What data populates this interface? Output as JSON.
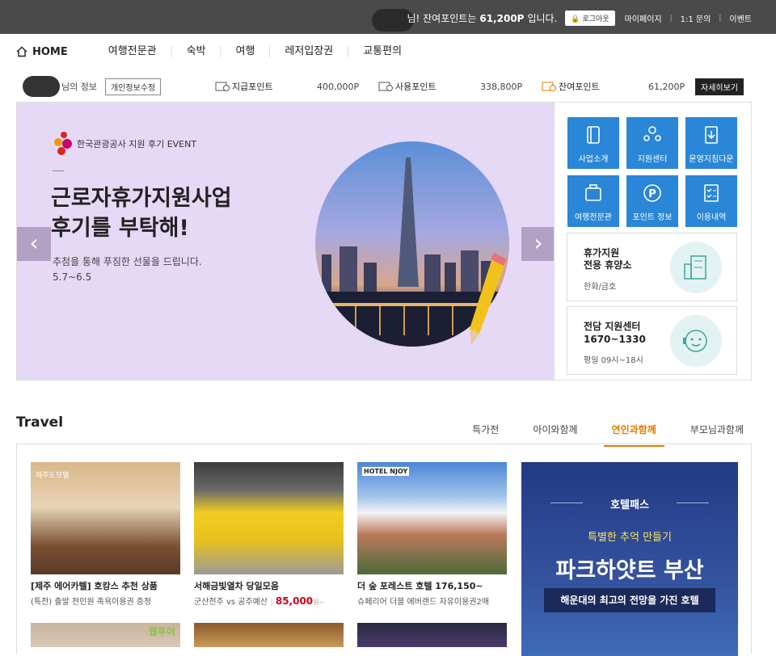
{
  "topbar": {
    "greeting": "님! 잔여포인트는",
    "points": "61,200P",
    "suffix": "입니다.",
    "logout": "로그아웃",
    "links": [
      "마이페이지",
      "1:1 문의",
      "이벤트"
    ]
  },
  "gnb": {
    "home": "HOME",
    "menus": [
      "여행전문관",
      "숙박",
      "여행",
      "레저입장권",
      "교통편의"
    ]
  },
  "info": {
    "label": "님의 정보",
    "edit": "개인정보수정",
    "given_label": "지급포인트",
    "given_value": "400,000P",
    "used_label": "사용포인트",
    "used_value": "338,800P",
    "remain_label": "잔여포인트",
    "remain_value": "61,200P",
    "detail": "자세히보기"
  },
  "banner": {
    "brand": "한국관광공사 지원 후기 EVENT",
    "headline1": "근로자휴가지원사업",
    "headline2": "후기를 부탁해!",
    "sub1": "추첨을 통해 푸짐한 선물을 드립니다.",
    "sub2": "5.7~6.5",
    "prev": "‹",
    "next": "›"
  },
  "quick": {
    "tiles": [
      "사업소개",
      "지원센터",
      "운영지침다운",
      "여행전문관",
      "포인트 정보",
      "이용내역"
    ],
    "resort_title1": "휴가지원",
    "resort_title2": "전용 휴양소",
    "resort_sub": "한화/금호",
    "center_title": "전담 지원센터",
    "center_phone": "1670~1330",
    "center_hours": "평일 09시~18시"
  },
  "travel": {
    "title": "Travel",
    "tabs": [
      "특가전",
      "아이와함께",
      "연인과함께",
      "부모님과함께"
    ],
    "active_tab": 2,
    "products": [
      {
        "badge": "제주도모텔",
        "title": "[제주 에어카텔] 호캉스 추천 상품",
        "desc": "(특전) 출발 전인원 족욕이용권 증정"
      },
      {
        "title": "서해금빛열차 당일모음",
        "desc": "군산전주 vs 공주예산",
        "price": "85,000",
        "unit": "원~"
      },
      {
        "badge": "HOTEL NJOY",
        "title": "더 숲 포레스트 호텔 176,150~",
        "desc": "슈페리어 더블 에버랜드 자유이용권2매"
      }
    ],
    "second_row_badge": "웹투어",
    "ad": {
      "brand": "호텔패스",
      "sub": "특별한 추억 만들기",
      "title": "파크하얏트 부산",
      "band": "해운대의 최고의 전망을 가진 호텔"
    }
  },
  "colors": {
    "accent": "#e07b00",
    "tile": "#2a86d6",
    "banner": "#e6d9f6",
    "topbar": "#4a4a4a"
  }
}
